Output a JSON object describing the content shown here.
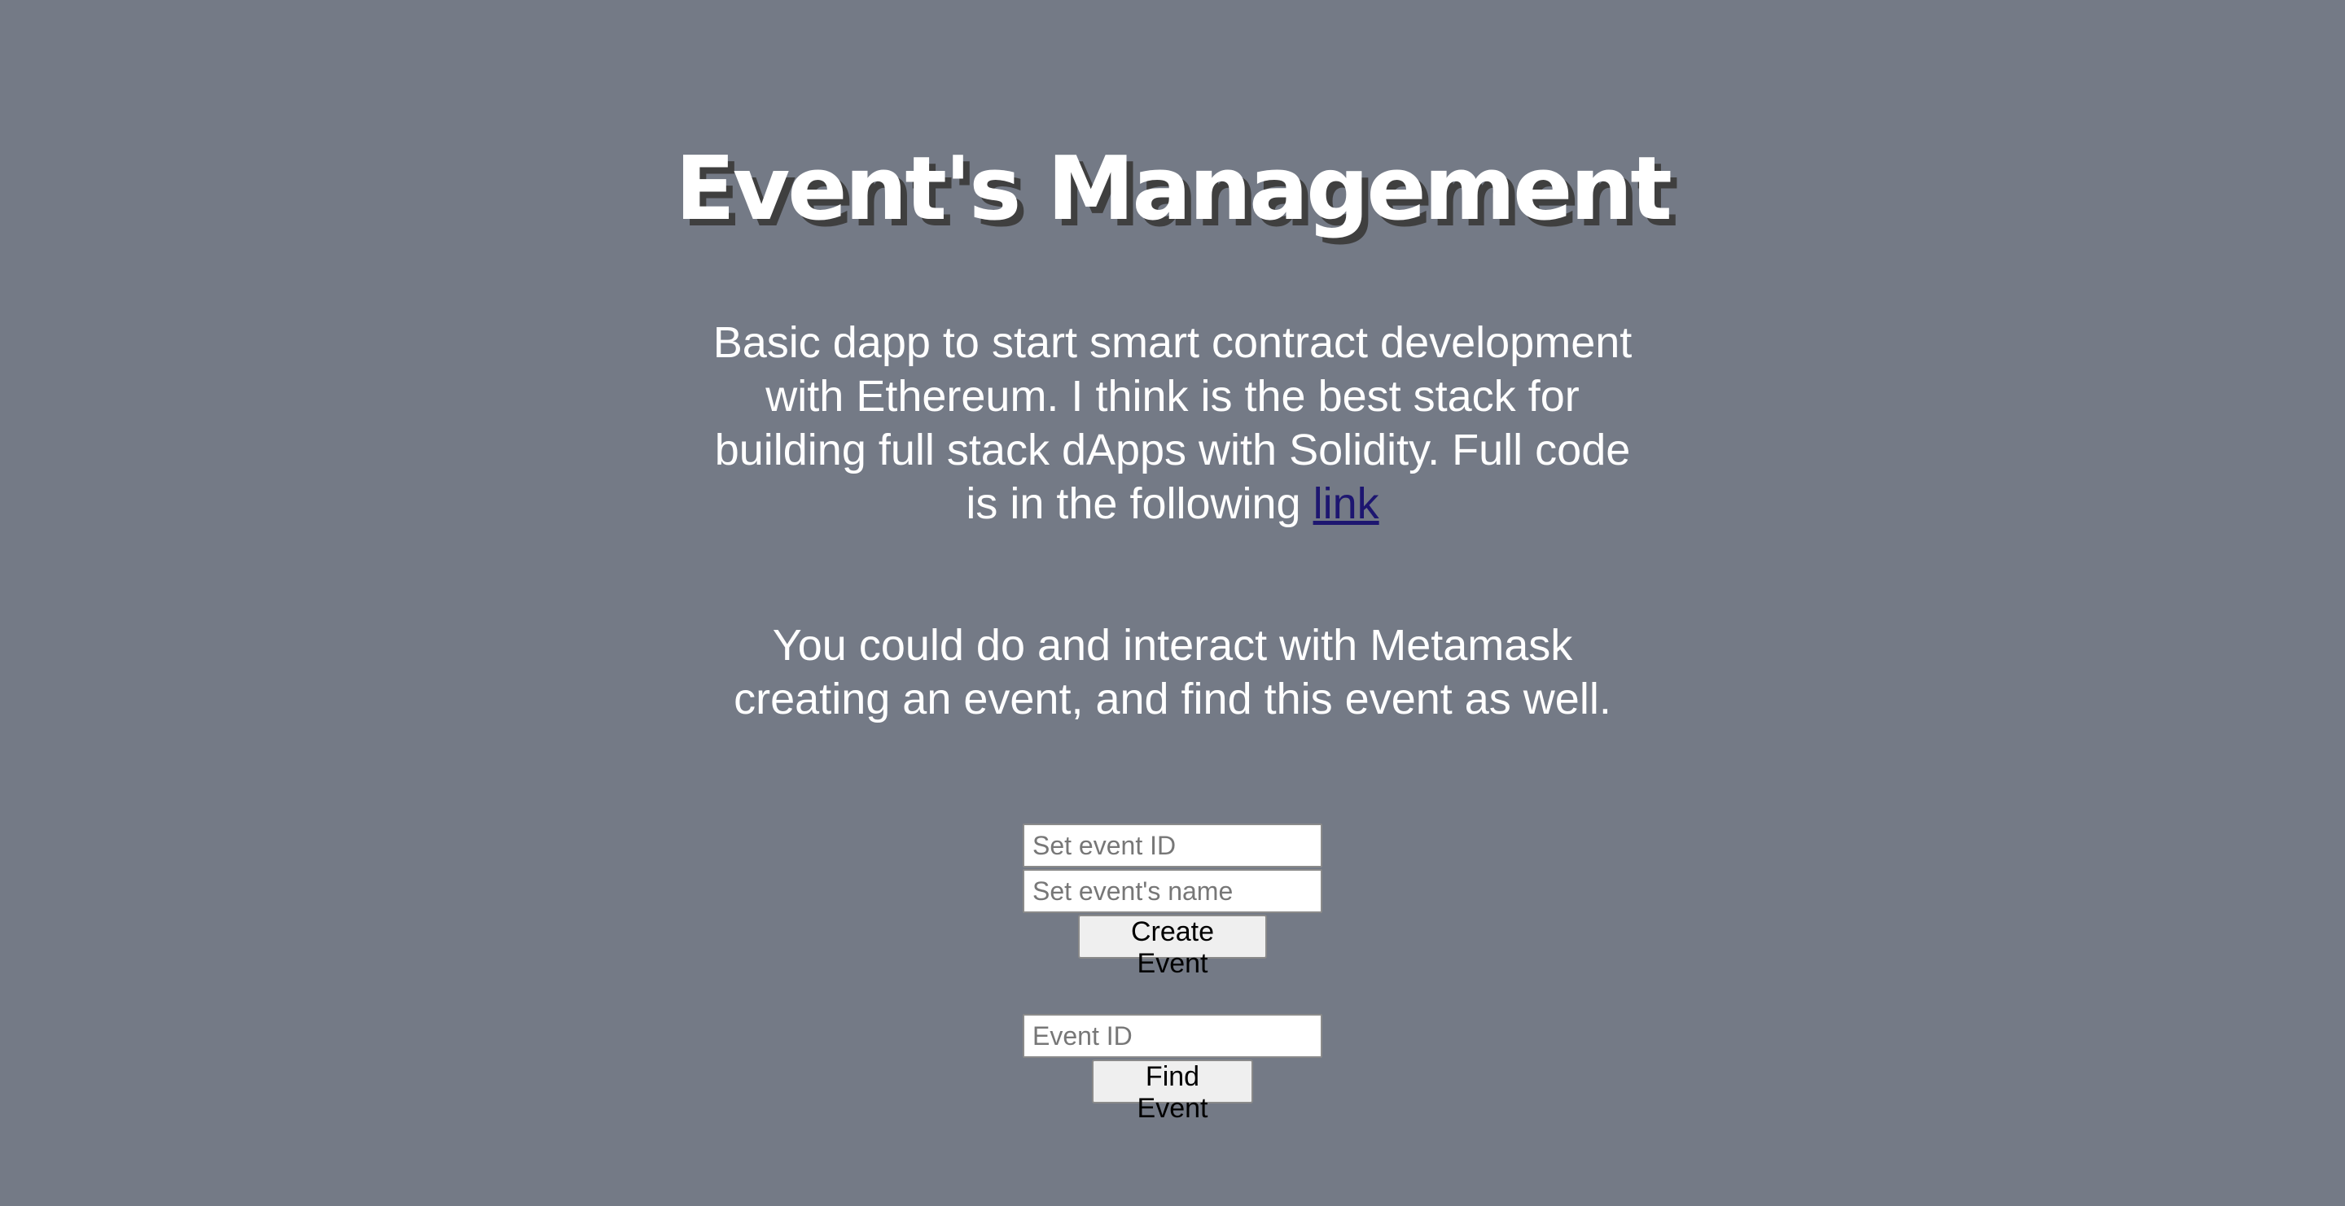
{
  "header": {
    "title": "Event's Management"
  },
  "intro": {
    "text": "Basic dapp to start smart contract development with Ethereum. I think is the best stack for building full stack dApps with Solidity. Full code is in the following ",
    "link_label": "link"
  },
  "metamask_text": "You could do and interact with Metamask creating an event, and find this event as well.",
  "create_form": {
    "event_id_placeholder": "Set event ID",
    "event_id_value": "",
    "event_name_placeholder": "Set event's name",
    "event_name_value": "",
    "create_button_label": "Create Event"
  },
  "find_form": {
    "event_id_placeholder": "Event ID",
    "event_id_value": "",
    "find_button_label": "Find Event"
  },
  "colors": {
    "background": "#747a86",
    "text": "#ffffff",
    "link": "#1d1670",
    "title_shadow": "#3f3f3f"
  }
}
